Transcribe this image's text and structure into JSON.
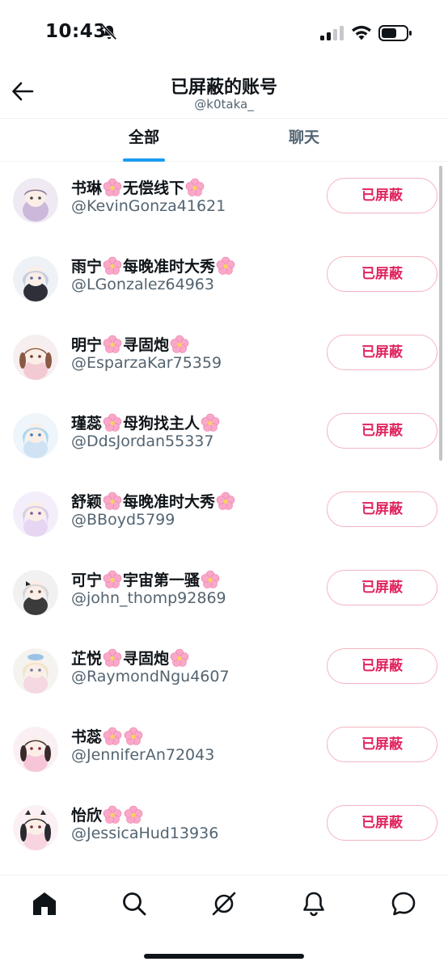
{
  "status_bar": {
    "time": "10:43"
  },
  "header": {
    "title": "已屏蔽的账号",
    "subtitle": "@k0taka_"
  },
  "tabs": [
    {
      "label": "全部",
      "active": true
    },
    {
      "label": "聊天",
      "active": false
    }
  ],
  "accounts": [
    {
      "name_before": "书琳",
      "name_middle": "无偿线下",
      "handle": "@KevinGonza41621",
      "button_label": "已屏蔽"
    },
    {
      "name_before": "雨宁",
      "name_middle": "每晚准时大秀",
      "handle": "@LGonzalez64963",
      "button_label": "已屏蔽"
    },
    {
      "name_before": "明宁",
      "name_middle": "寻固炮",
      "handle": "@EsparzaKar75359",
      "button_label": "已屏蔽"
    },
    {
      "name_before": "瑾蕊",
      "name_middle": "母狗找主人",
      "handle": "@DdsJordan55337",
      "button_label": "已屏蔽"
    },
    {
      "name_before": "舒颖",
      "name_middle": "每晚准时大秀",
      "handle": "@BBoyd5799",
      "button_label": "已屏蔽"
    },
    {
      "name_before": "可宁",
      "name_middle": "宇宙第一骚",
      "handle": "@john_thomp92869",
      "button_label": "已屏蔽"
    },
    {
      "name_before": "芷悦",
      "name_middle": "寻固炮",
      "handle": "@RaymondNgu4607",
      "button_label": "已屏蔽"
    },
    {
      "name_before": "书蕊",
      "name_middle": "",
      "handle": "@JenniferAn72043",
      "button_label": "已屏蔽"
    },
    {
      "name_before": "怡欣",
      "name_middle": "",
      "handle": "@JessicaHud13936",
      "button_label": "已屏蔽"
    }
  ],
  "bottom_nav": [
    {
      "icon": "home-icon"
    },
    {
      "icon": "search-icon"
    },
    {
      "icon": "grok-icon"
    },
    {
      "icon": "bell-icon"
    },
    {
      "icon": "messages-icon"
    }
  ],
  "colors": {
    "accent": "#1d9bf0",
    "blocked_text": "#e0245e",
    "blocked_border": "#f4b4c0",
    "secondary_text": "#536471"
  }
}
